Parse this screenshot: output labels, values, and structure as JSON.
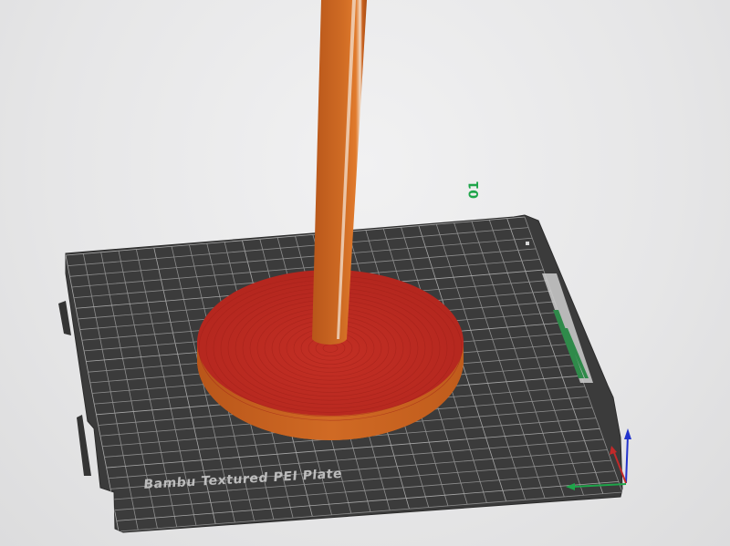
{
  "plate": {
    "name": "Bambu Textured PEI Plate",
    "number": "01"
  },
  "colors": {
    "background": "#e9e9ea",
    "plate": "#3b3b3b",
    "grid": "#8e8e8e",
    "model_side": "#c7641f",
    "model_top": "#b3261e",
    "axis_x": "#1fa54a",
    "axis_y": "#c22a2a",
    "axis_z": "#2233cc",
    "plate_number": "#1fa54a"
  },
  "icons": [
    "axis-gizmo-icon"
  ]
}
